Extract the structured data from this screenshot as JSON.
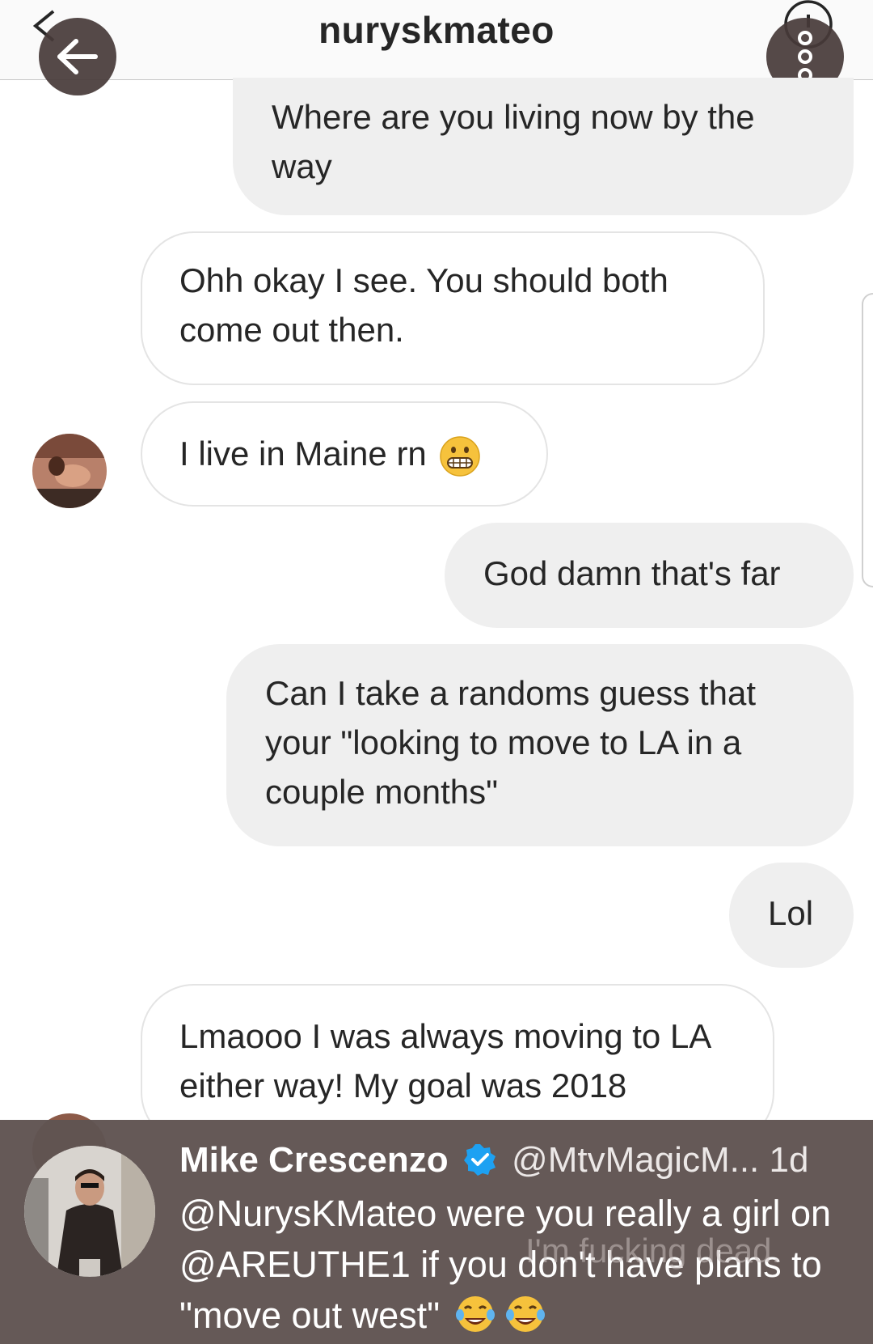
{
  "header": {
    "title": "nuryskmateo"
  },
  "messages": [
    {
      "side": "sent",
      "text": "Where are you living now by the way"
    },
    {
      "side": "received",
      "text": "Ohh okay I see. You should both come out then."
    },
    {
      "side": "received",
      "text": "I live in Maine rn",
      "emoji": "grimacing-face"
    },
    {
      "side": "sent",
      "text": "God damn that's far"
    },
    {
      "side": "sent",
      "text": "Can I take a randoms guess that your \"looking to move to LA in a couple months\""
    },
    {
      "side": "sent",
      "text": "Lol"
    },
    {
      "side": "received",
      "text": "Lmaooo I was always moving to LA either way! My goal was 2018"
    },
    {
      "side": "sent",
      "text": "I'm fucking dead."
    }
  ],
  "tweet": {
    "name": "Mike Crescenzo",
    "handle": "@MtvMagicM...",
    "time": "1d",
    "body": "@NurysKMateo were you really a girl on @AREUTHE1 if you don't have plans to \"move out west\"",
    "emojis": [
      "tears-of-joy",
      "tears-of-joy"
    ]
  },
  "colors": {
    "sent_bubble": "#efefef",
    "received_border": "#e4e4e4",
    "tweet_overlay": "#605452",
    "verified": "#1da1f2"
  }
}
